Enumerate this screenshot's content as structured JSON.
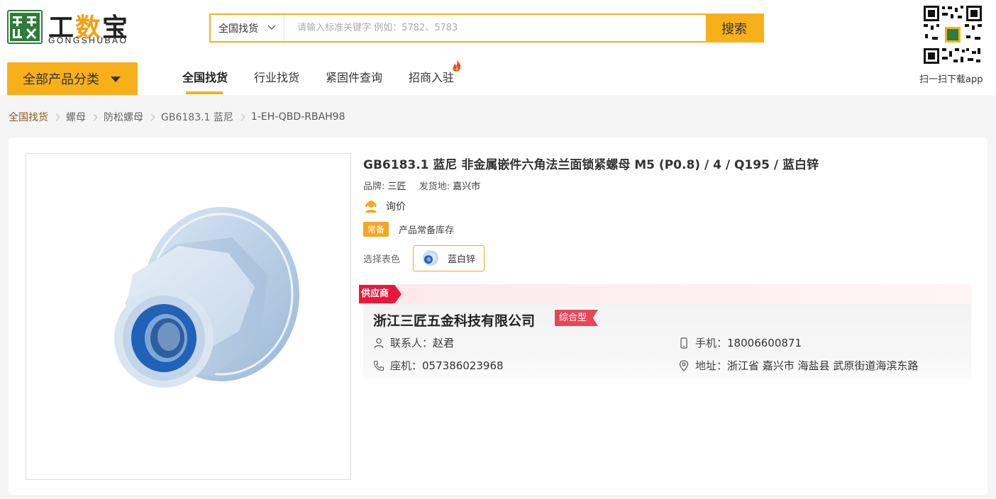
{
  "logo": {
    "cn_part1": "工",
    "cn_part2": "数",
    "cn_part3": "宝",
    "en": "GONGSHUBAO"
  },
  "search": {
    "scope": "全国找货",
    "placeholder": "请输入标准关键字 例如：5782、5783",
    "button": "搜索"
  },
  "qr": {
    "caption": "扫一扫下载app"
  },
  "nav": {
    "category_button": "全部产品分类",
    "items": [
      {
        "label": "全国找货",
        "active": true
      },
      {
        "label": "行业找货",
        "active": false
      },
      {
        "label": "紧固件查询",
        "active": false
      },
      {
        "label": "招商入驻",
        "active": false
      }
    ]
  },
  "breadcrumb": [
    "全国找货",
    "螺母",
    "防松螺母",
    "GB6183.1 蓝尼",
    "1-EH-QBD-RBAH98"
  ],
  "product": {
    "title": "GB6183.1 蓝尼 非金属嵌件六角法兰面锁紧螺母 M5 (P0.8) / 4 / Q195 / 蓝白锌",
    "brand_label": "品牌:",
    "brand": "三匠",
    "origin_label": "发货地:",
    "origin": "嘉兴市",
    "inquiry": "询价",
    "stock_badge": "常备",
    "stock_text": "产品常备库存",
    "color_label": "选择表色",
    "color_option": "蓝白锌"
  },
  "supplier": {
    "tag": "供应商",
    "name": "浙江三匠五金科技有限公司",
    "type": "综合型",
    "contact_label": "联系人：",
    "contact": "赵君",
    "phone_label": "手机：",
    "phone": "18006600871",
    "landline_label": "座机：",
    "landline": "057386023968",
    "address_label": "地址：",
    "address": "浙江省 嘉兴市 海盐县 武原街道海滨东路"
  },
  "colors": {
    "accent": "#f8b01a",
    "brand_green": "#2e7d3a",
    "supplier_red": "#e8183c",
    "type_badge": "#e8465a"
  }
}
